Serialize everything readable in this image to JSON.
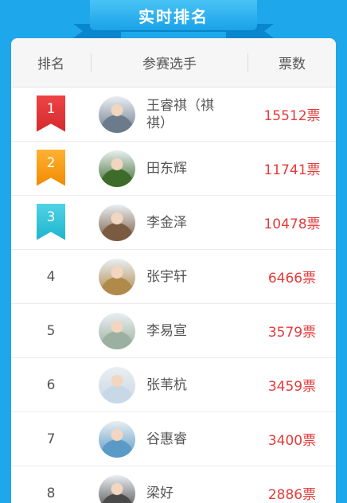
{
  "banner": {
    "title": "实时排名"
  },
  "table": {
    "headers": {
      "rank": "排名",
      "player": "参赛选手",
      "votes": "票数"
    },
    "rows": [
      {
        "rank": "1",
        "badge": "red",
        "name": "王睿祺（祺祺）",
        "votes": "15512票",
        "avatar_color": "#6b7b8c"
      },
      {
        "rank": "2",
        "badge": "gold",
        "name": "田东辉",
        "votes": "11741票",
        "avatar_color": "#3d6b2a"
      },
      {
        "rank": "3",
        "badge": "cyan",
        "name": "李金泽",
        "votes": "10478票",
        "avatar_color": "#7a5a40"
      },
      {
        "rank": "4",
        "badge": "",
        "name": "张宇轩",
        "votes": "6466票",
        "avatar_color": "#b08a4a"
      },
      {
        "rank": "5",
        "badge": "",
        "name": "李易宣",
        "votes": "3579票",
        "avatar_color": "#9bb0a0"
      },
      {
        "rank": "6",
        "badge": "",
        "name": "张苇杭",
        "votes": "3459票",
        "avatar_color": "#c8d8e6"
      },
      {
        "rank": "7",
        "badge": "",
        "name": "谷惠睿",
        "votes": "3400票",
        "avatar_color": "#5a9ac6"
      },
      {
        "rank": "8",
        "badge": "",
        "name": "梁好",
        "votes": "2886票",
        "avatar_color": "#4a4a4a"
      }
    ]
  },
  "colors": {
    "accent": "#1ea7ea",
    "votes": "#e53b3b"
  }
}
